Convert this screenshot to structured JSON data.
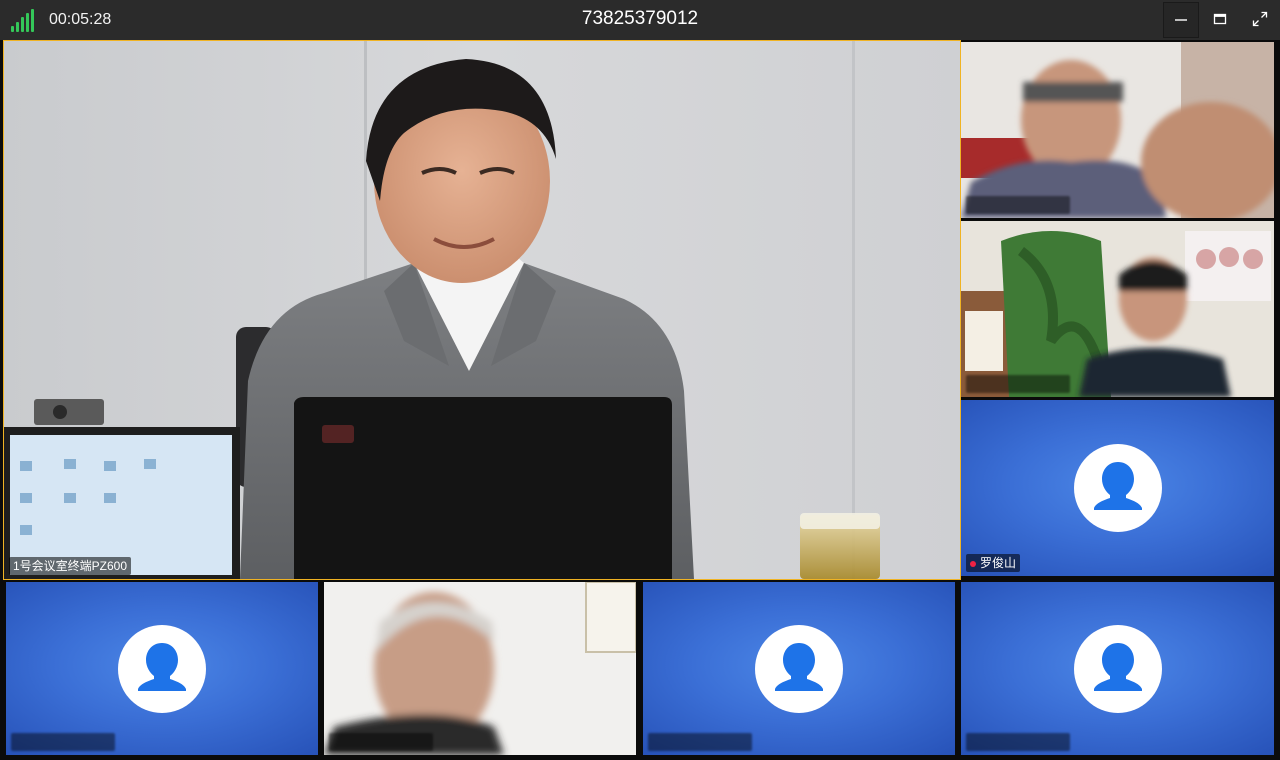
{
  "topbar": {
    "signal_icon": "signal-bars-icon",
    "elapsed": "00:05:28",
    "meeting_id": "73825379012",
    "buttons": {
      "minimize_icon": "minimize-icon",
      "maximize_icon": "maximize-icon",
      "fullscreen_icon": "fullscreen-icon"
    }
  },
  "main_tile": {
    "label": "1号会议室终端PZ600"
  },
  "participants": [
    {
      "kind": "video",
      "label": ""
    },
    {
      "kind": "video",
      "label": ""
    },
    {
      "kind": "avatar",
      "label": "罗俊山"
    },
    {
      "kind": "avatar",
      "label": ""
    },
    {
      "kind": "video",
      "label": ""
    },
    {
      "kind": "avatar",
      "label": ""
    },
    {
      "kind": "avatar",
      "label": ""
    }
  ],
  "colors": {
    "accent": "#f0b323",
    "signal": "#34c759",
    "tile_blue": "#3b6fd6"
  }
}
